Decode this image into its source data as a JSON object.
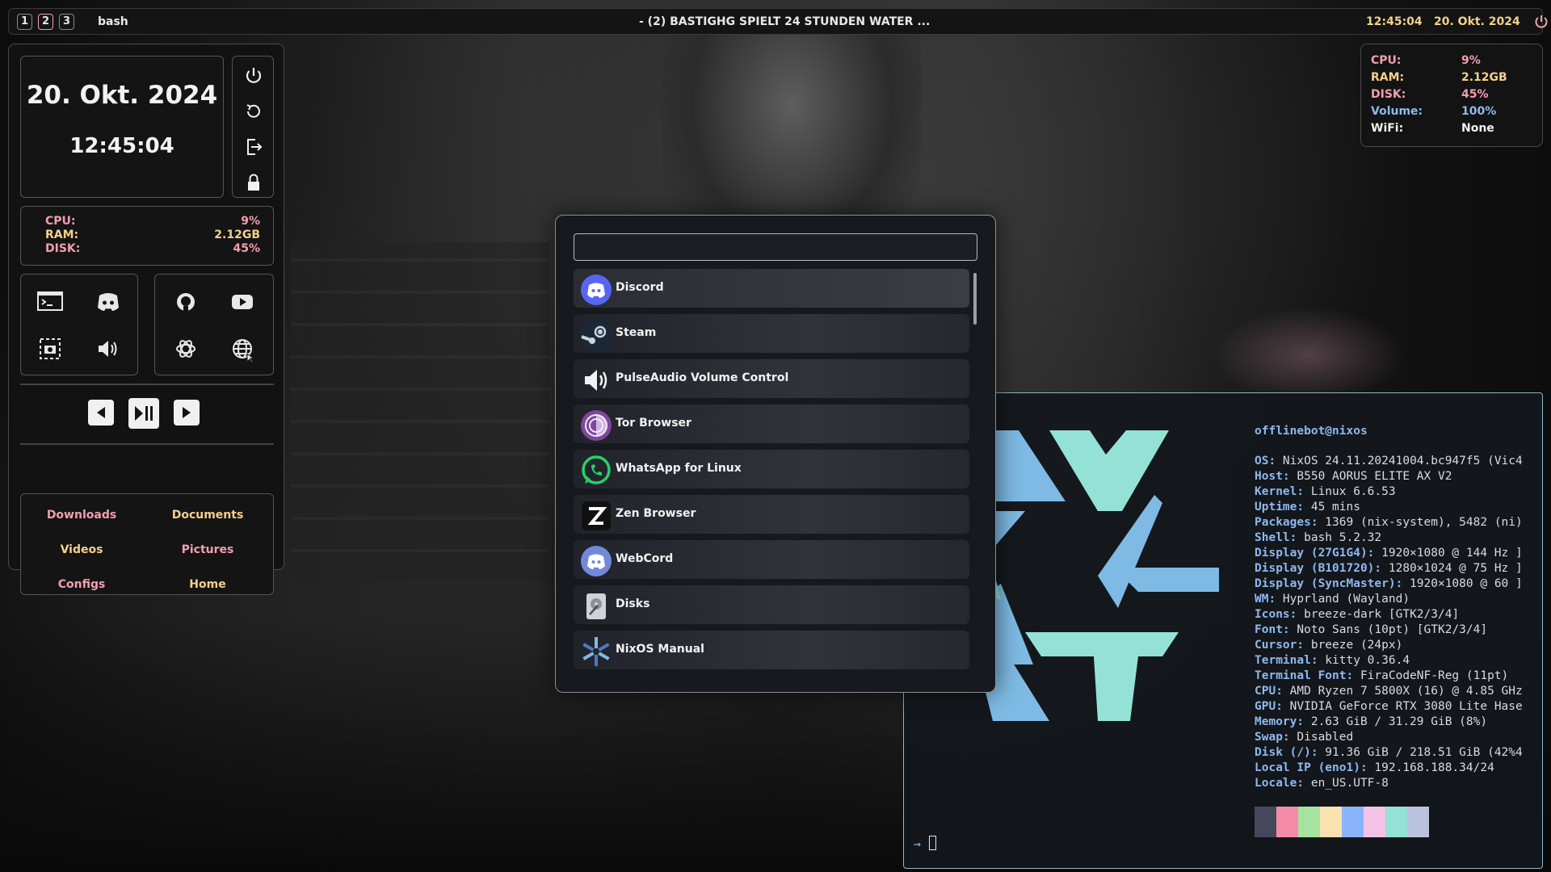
{
  "topbar": {
    "workspaces": [
      "1",
      "2",
      "3"
    ],
    "active_workspace": "2",
    "app": "bash",
    "window_title": "- (2) BASTIGHG SPIELT 24 STUNDEN WATER ...",
    "time": "12:45:04",
    "date": "20. Okt. 2024",
    "power_icon": "power-icon"
  },
  "dashboard": {
    "clock": {
      "date": "20. Okt. 2024",
      "time": "12:45:04"
    },
    "power_menu": [
      "power-icon",
      "restart-icon",
      "logout-icon",
      "lock-icon"
    ],
    "stats": [
      {
        "label": "CPU:",
        "value": "9%"
      },
      {
        "label": "RAM:",
        "value": "2.12GB"
      },
      {
        "label": "DISK:",
        "value": "45%"
      }
    ],
    "apps_left": [
      "terminal-icon",
      "discord-icon",
      "screenshot-icon",
      "volume-icon"
    ],
    "apps_right": [
      "github-icon",
      "youtube-icon",
      "chatgpt-icon",
      "browser-icon"
    ],
    "media": [
      "previous-icon",
      "play-pause-icon",
      "next-icon"
    ],
    "folders": [
      "Downloads",
      "Documents",
      "Videos",
      "Pictures",
      "Configs",
      "Home"
    ]
  },
  "sysinfo": [
    {
      "label": "CPU:",
      "value": "9%"
    },
    {
      "label": "RAM:",
      "value": "2.12GB"
    },
    {
      "label": "DISK:",
      "value": "45%"
    },
    {
      "label": "Volume:",
      "value": "100%"
    },
    {
      "label": "WiFi:",
      "value": "None"
    }
  ],
  "launcher": {
    "search_value": "",
    "items": [
      {
        "label": "Discord",
        "icon": "discord-icon"
      },
      {
        "label": "Steam",
        "icon": "steam-icon"
      },
      {
        "label": "PulseAudio Volume Control",
        "icon": "speaker-icon"
      },
      {
        "label": "Tor Browser",
        "icon": "tor-icon"
      },
      {
        "label": "WhatsApp for Linux",
        "icon": "whatsapp-icon"
      },
      {
        "label": "Zen Browser",
        "icon": "zen-icon"
      },
      {
        "label": "WebCord",
        "icon": "webcord-icon"
      },
      {
        "label": "Disks",
        "icon": "disks-icon"
      },
      {
        "label": "NixOS Manual",
        "icon": "nixos-icon"
      }
    ]
  },
  "terminal": {
    "user": "offlinebot@nixos",
    "fetch": [
      {
        "key": "OS:",
        "value": " NixOS 24.11.20241004.bc947f5 (Vic4"
      },
      {
        "key": "Host:",
        "value": " B550 AORUS ELITE AX V2"
      },
      {
        "key": "Kernel:",
        "value": " Linux 6.6.53"
      },
      {
        "key": "Uptime:",
        "value": " 45 mins"
      },
      {
        "key": "Packages:",
        "value": " 1369 (nix-system), 5482 (ni)"
      },
      {
        "key": "Shell:",
        "value": " bash 5.2.32"
      },
      {
        "key": "Display (27G1G4):",
        "value": " 1920×1080 @ 144 Hz ]"
      },
      {
        "key": "Display (B101720):",
        "value": " 1280×1024 @ 75 Hz ]"
      },
      {
        "key": "Display (SyncMaster):",
        "value": " 1920×1080 @ 60 ]"
      },
      {
        "key": "WM:",
        "value": " Hyprland (Wayland)"
      },
      {
        "key": "Icons:",
        "value": " breeze-dark [GTK2/3/4]"
      },
      {
        "key": "Font:",
        "value": " Noto Sans (10pt) [GTK2/3/4]"
      },
      {
        "key": "Cursor:",
        "value": " breeze (24px)"
      },
      {
        "key": "Terminal:",
        "value": " kitty 0.36.4"
      },
      {
        "key": "Terminal Font:",
        "value": " FiraCodeNF-Reg (11pt)"
      },
      {
        "key": "CPU:",
        "value": " AMD Ryzen 7 5800X (16) @ 4.85 GHz"
      },
      {
        "key": "GPU:",
        "value": " NVIDIA GeForce RTX 3080 Lite Hase"
      },
      {
        "key": "Memory:",
        "value": " 2.63 GiB / 31.29 GiB (8%)"
      },
      {
        "key": "Swap:",
        "value": " Disabled"
      },
      {
        "key": "Disk (/):",
        "value": " 91.36 GiB / 218.51 GiB (42%4"
      },
      {
        "key": "Local IP (eno1):",
        "value": " 192.168.188.34/24"
      },
      {
        "key": "Locale:",
        "value": " en_US.UTF-8"
      }
    ],
    "palette": [
      "#45475a",
      "#f38ba8",
      "#a6e3a1",
      "#f9e2af",
      "#89b4fa",
      "#f5c2e7",
      "#94e2d5",
      "#bac2de"
    ],
    "prompt": "→"
  },
  "colors": {
    "accent_pink": "#f29fb0",
    "accent_yellow": "#f5d08c",
    "accent_blue": "#8fb8f0",
    "nix_blue": "#7ebae4",
    "nix_teal": "#94e2d5"
  }
}
